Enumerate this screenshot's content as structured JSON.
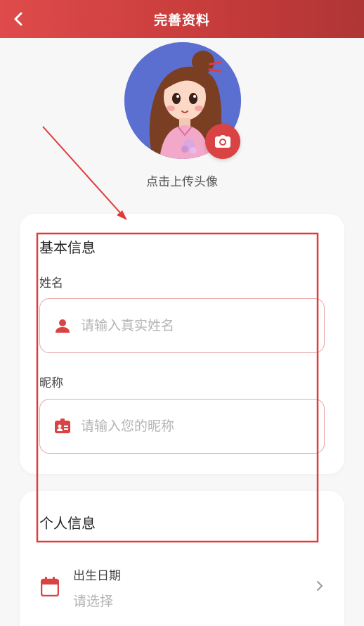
{
  "header": {
    "title": "完善资料"
  },
  "avatar": {
    "upload_tip": "点击上传头像"
  },
  "basic_info": {
    "section_title": "基本信息",
    "name": {
      "label": "姓名",
      "placeholder": "请输入真实姓名",
      "value": ""
    },
    "nickname": {
      "label": "昵称",
      "placeholder": "请输入您的昵称",
      "value": ""
    }
  },
  "personal_info": {
    "section_title": "个人信息",
    "birthday": {
      "label": "出生日期",
      "value": "请选择"
    }
  },
  "colors": {
    "brand": "#d94343",
    "input_border": "#e9a5a5",
    "annotation": "#e03a3a"
  },
  "icons": {
    "back": "chevron-left-icon",
    "camera": "camera-icon",
    "user": "user-icon",
    "badge": "id-badge-icon",
    "calendar": "calendar-icon",
    "arrow": "chevron-right-icon"
  }
}
